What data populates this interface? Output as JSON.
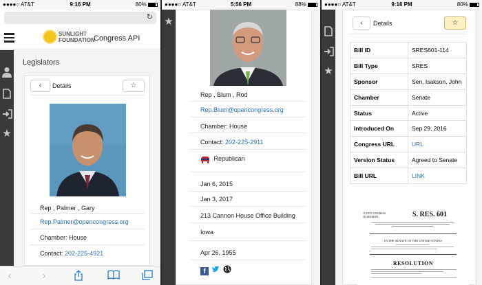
{
  "panel1": {
    "status": {
      "carrier": "●●●●○ AT&T",
      "time": "9:16 PM",
      "battery": "80%"
    },
    "app": {
      "org_line1": "SUNLIGHT",
      "org_line2": "FOUNDATION",
      "title": "Congress API"
    },
    "section_title": "Legislators",
    "back_label": "‹",
    "details_label": "Details",
    "star_label": "☆",
    "name": "Rep , Palmer , Gary",
    "email": "Rep.Palmer@opencongress.org",
    "chamber": "Chamber: House",
    "contact_label": "Contact:",
    "contact_phone": "202-225-4921",
    "bottom_icons": [
      "back-arrow",
      "forward-arrow",
      "share",
      "bookmarks",
      "tabs"
    ]
  },
  "panel2": {
    "status": {
      "carrier": "●●●●○ AT&T",
      "time": "5:56 PM",
      "battery": "88%"
    },
    "name": "Rep , Blum , Rod",
    "email": "Rep.Blum@opencongress.org",
    "chamber": "Chamber: House",
    "contact_label": "Contact:",
    "contact_phone": "202-225-2911",
    "party": "Republican",
    "term_start": "Jan 6, 2015",
    "term_end": "Jan 3, 2017",
    "office": "213 Cannon House Office Building",
    "state": "Iowa",
    "birthday": "Apr 26, 1955"
  },
  "panel3": {
    "status": {
      "carrier": "●●●●○ AT&T",
      "time": "9:16 PM",
      "battery": "80%"
    },
    "back_label": "‹",
    "details_label": "Details",
    "star_label": "☆",
    "table": [
      {
        "key": "Bill ID",
        "value": "SRES601-114"
      },
      {
        "key": "Bill Type",
        "value": "SRES"
      },
      {
        "key": "Sponsor",
        "value": "Sen, Isakson, John"
      },
      {
        "key": "Chamber",
        "value": "Senate"
      },
      {
        "key": "Status",
        "value": "Active"
      },
      {
        "key": "Introduced On",
        "value": "Sep 29, 2016"
      },
      {
        "key": "Congress URL",
        "value": "URL"
      },
      {
        "key": "Version Status",
        "value": "Agreed to Senate"
      },
      {
        "key": "Bill URL",
        "value": "LINK"
      }
    ],
    "doc": {
      "congress": "114TH CONGRESS",
      "session": "2D SESSION",
      "bill": "S. RES. 601",
      "in_senate": "IN THE SENATE OF THE UNITED STATES",
      "heading": "RESOLUTION"
    }
  },
  "colors": {
    "accent": "#2a70b8",
    "rail": "#3a3a3a",
    "star": "#e8c020",
    "republican": "#c0272d"
  }
}
